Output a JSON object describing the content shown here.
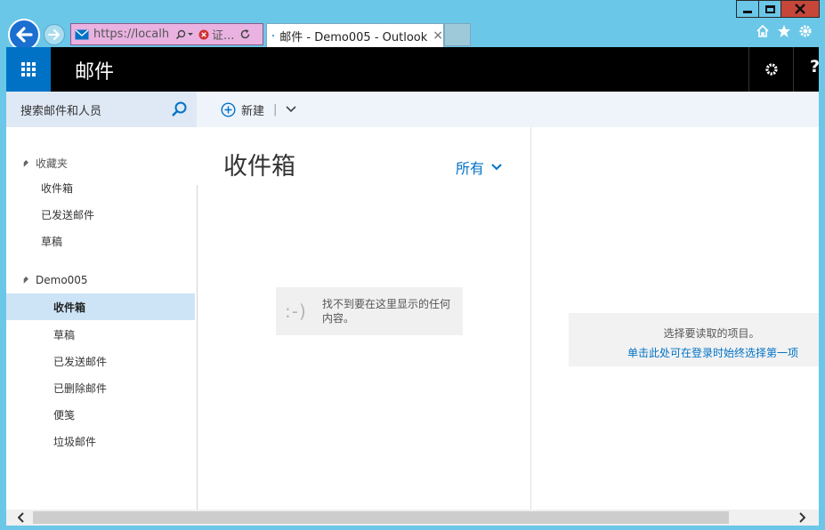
{
  "browser": {
    "address_url": "https://localh...",
    "cert_label": "证...",
    "tab_title": "邮件 - Demo005 - Outlook",
    "tab_close": "×"
  },
  "suite": {
    "app_title": "邮件",
    "help_label": "?"
  },
  "search": {
    "placeholder": "搜索邮件和人员"
  },
  "command_bar": {
    "new_label": "新建",
    "separator": "|"
  },
  "left_nav": {
    "favorites_header": "收藏夹",
    "favorites": [
      "收件箱",
      "已发送邮件",
      "草稿"
    ],
    "account_header": "Demo005",
    "folders": [
      "收件箱",
      "草稿",
      "已发送邮件",
      "已删除邮件",
      "便笺",
      "垃圾邮件"
    ],
    "selected_folder_index": 0
  },
  "message_list": {
    "heading": "收件箱",
    "filter_label": "所有",
    "empty_face": ":-)",
    "empty_text": "找不到要在这里显示的任何内容。"
  },
  "reading_pane": {
    "prompt": "选择要读取的项目。",
    "link": "单击此处可在登录时始终选择第一项"
  },
  "colors": {
    "accent": "#0072c6",
    "selection": "#cde4f7",
    "desktop": "#6bc7e8"
  }
}
